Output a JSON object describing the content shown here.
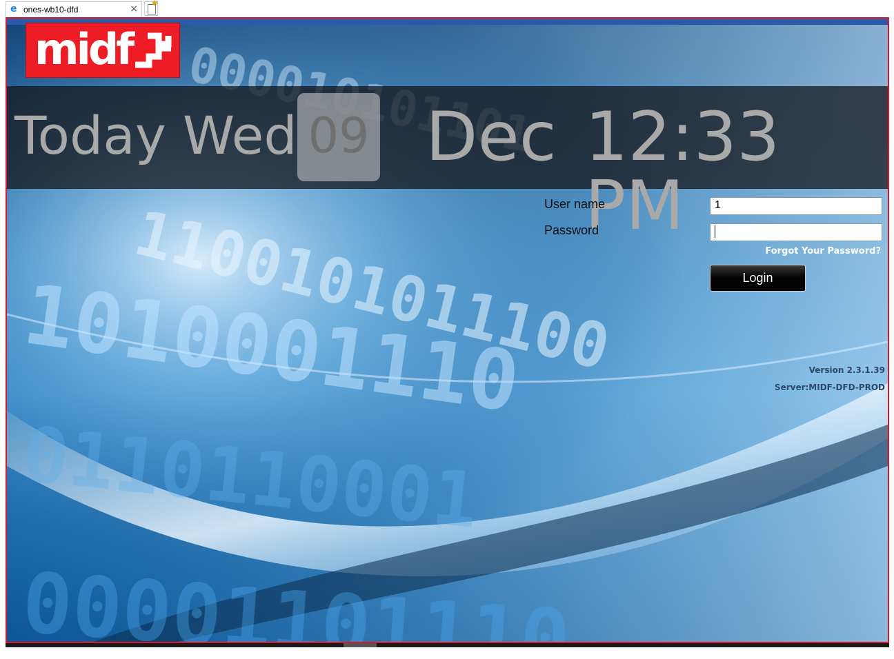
{
  "browser": {
    "tab_title": "ones-wb10-dfd",
    "tab_icon": "ie-browser-icon",
    "close_glyph": "×"
  },
  "brand": {
    "logo_text": "midf",
    "logo_color": "#ee1c25"
  },
  "datebar": {
    "today_label": "Today Wed",
    "day_number": "09",
    "month": "Dec",
    "time": "12:33 PM"
  },
  "login": {
    "username_label": "User name",
    "username_value": "1",
    "password_label": "Password",
    "password_value": "",
    "forgot_link": "Forgot Your Password?",
    "login_button": "Login"
  },
  "footer": {
    "version": "Version 2.3.1.39",
    "server": "Server:MIDF-DFD-PROD"
  },
  "colors": {
    "frame_border": "#d9182a",
    "top_bar": "#2c5aa8",
    "date_text": "#a9a9a9"
  }
}
